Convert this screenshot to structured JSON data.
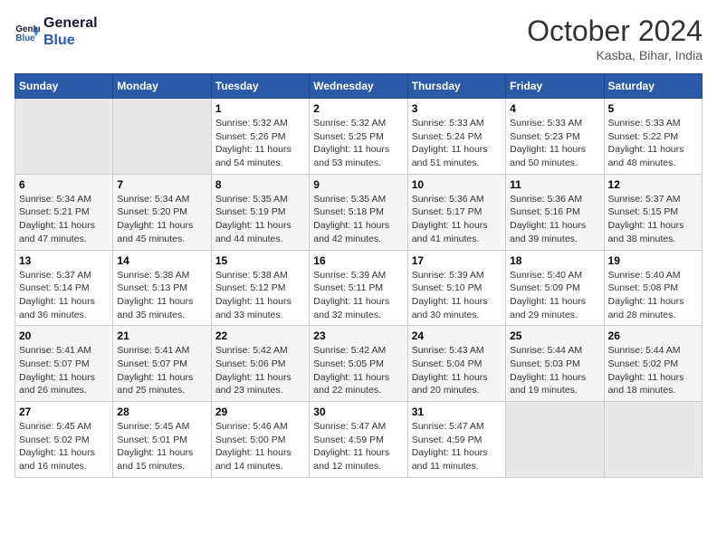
{
  "header": {
    "logo_line1": "General",
    "logo_line2": "Blue",
    "month": "October 2024",
    "location": "Kasba, Bihar, India"
  },
  "weekdays": [
    "Sunday",
    "Monday",
    "Tuesday",
    "Wednesday",
    "Thursday",
    "Friday",
    "Saturday"
  ],
  "weeks": [
    [
      {
        "day": "",
        "info": ""
      },
      {
        "day": "",
        "info": ""
      },
      {
        "day": "1",
        "info": "Sunrise: 5:32 AM\nSunset: 5:26 PM\nDaylight: 11 hours and 54 minutes."
      },
      {
        "day": "2",
        "info": "Sunrise: 5:32 AM\nSunset: 5:25 PM\nDaylight: 11 hours and 53 minutes."
      },
      {
        "day": "3",
        "info": "Sunrise: 5:33 AM\nSunset: 5:24 PM\nDaylight: 11 hours and 51 minutes."
      },
      {
        "day": "4",
        "info": "Sunrise: 5:33 AM\nSunset: 5:23 PM\nDaylight: 11 hours and 50 minutes."
      },
      {
        "day": "5",
        "info": "Sunrise: 5:33 AM\nSunset: 5:22 PM\nDaylight: 11 hours and 48 minutes."
      }
    ],
    [
      {
        "day": "6",
        "info": "Sunrise: 5:34 AM\nSunset: 5:21 PM\nDaylight: 11 hours and 47 minutes."
      },
      {
        "day": "7",
        "info": "Sunrise: 5:34 AM\nSunset: 5:20 PM\nDaylight: 11 hours and 45 minutes."
      },
      {
        "day": "8",
        "info": "Sunrise: 5:35 AM\nSunset: 5:19 PM\nDaylight: 11 hours and 44 minutes."
      },
      {
        "day": "9",
        "info": "Sunrise: 5:35 AM\nSunset: 5:18 PM\nDaylight: 11 hours and 42 minutes."
      },
      {
        "day": "10",
        "info": "Sunrise: 5:36 AM\nSunset: 5:17 PM\nDaylight: 11 hours and 41 minutes."
      },
      {
        "day": "11",
        "info": "Sunrise: 5:36 AM\nSunset: 5:16 PM\nDaylight: 11 hours and 39 minutes."
      },
      {
        "day": "12",
        "info": "Sunrise: 5:37 AM\nSunset: 5:15 PM\nDaylight: 11 hours and 38 minutes."
      }
    ],
    [
      {
        "day": "13",
        "info": "Sunrise: 5:37 AM\nSunset: 5:14 PM\nDaylight: 11 hours and 36 minutes."
      },
      {
        "day": "14",
        "info": "Sunrise: 5:38 AM\nSunset: 5:13 PM\nDaylight: 11 hours and 35 minutes."
      },
      {
        "day": "15",
        "info": "Sunrise: 5:38 AM\nSunset: 5:12 PM\nDaylight: 11 hours and 33 minutes."
      },
      {
        "day": "16",
        "info": "Sunrise: 5:39 AM\nSunset: 5:11 PM\nDaylight: 11 hours and 32 minutes."
      },
      {
        "day": "17",
        "info": "Sunrise: 5:39 AM\nSunset: 5:10 PM\nDaylight: 11 hours and 30 minutes."
      },
      {
        "day": "18",
        "info": "Sunrise: 5:40 AM\nSunset: 5:09 PM\nDaylight: 11 hours and 29 minutes."
      },
      {
        "day": "19",
        "info": "Sunrise: 5:40 AM\nSunset: 5:08 PM\nDaylight: 11 hours and 28 minutes."
      }
    ],
    [
      {
        "day": "20",
        "info": "Sunrise: 5:41 AM\nSunset: 5:07 PM\nDaylight: 11 hours and 26 minutes."
      },
      {
        "day": "21",
        "info": "Sunrise: 5:41 AM\nSunset: 5:07 PM\nDaylight: 11 hours and 25 minutes."
      },
      {
        "day": "22",
        "info": "Sunrise: 5:42 AM\nSunset: 5:06 PM\nDaylight: 11 hours and 23 minutes."
      },
      {
        "day": "23",
        "info": "Sunrise: 5:42 AM\nSunset: 5:05 PM\nDaylight: 11 hours and 22 minutes."
      },
      {
        "day": "24",
        "info": "Sunrise: 5:43 AM\nSunset: 5:04 PM\nDaylight: 11 hours and 20 minutes."
      },
      {
        "day": "25",
        "info": "Sunrise: 5:44 AM\nSunset: 5:03 PM\nDaylight: 11 hours and 19 minutes."
      },
      {
        "day": "26",
        "info": "Sunrise: 5:44 AM\nSunset: 5:02 PM\nDaylight: 11 hours and 18 minutes."
      }
    ],
    [
      {
        "day": "27",
        "info": "Sunrise: 5:45 AM\nSunset: 5:02 PM\nDaylight: 11 hours and 16 minutes."
      },
      {
        "day": "28",
        "info": "Sunrise: 5:45 AM\nSunset: 5:01 PM\nDaylight: 11 hours and 15 minutes."
      },
      {
        "day": "29",
        "info": "Sunrise: 5:46 AM\nSunset: 5:00 PM\nDaylight: 11 hours and 14 minutes."
      },
      {
        "day": "30",
        "info": "Sunrise: 5:47 AM\nSunset: 4:59 PM\nDaylight: 11 hours and 12 minutes."
      },
      {
        "day": "31",
        "info": "Sunrise: 5:47 AM\nSunset: 4:59 PM\nDaylight: 11 hours and 11 minutes."
      },
      {
        "day": "",
        "info": ""
      },
      {
        "day": "",
        "info": ""
      }
    ]
  ]
}
